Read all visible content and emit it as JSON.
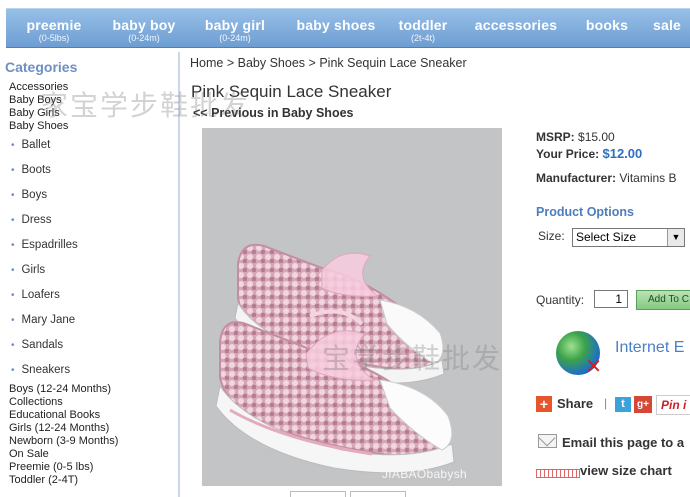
{
  "nav": [
    {
      "label": "preemie",
      "sub": "(0-5lbs)"
    },
    {
      "label": "baby boy",
      "sub": "(0-24m)"
    },
    {
      "label": "baby girl",
      "sub": "(0-24m)"
    },
    {
      "label": "baby shoes",
      "sub": ""
    },
    {
      "label": "toddler",
      "sub": "(2t-4t)"
    },
    {
      "label": "accessories",
      "sub": ""
    },
    {
      "label": "books",
      "sub": ""
    },
    {
      "label": "sale",
      "sub": ""
    }
  ],
  "sidebar": {
    "title": "Categories",
    "top_items": [
      "Accessories",
      "Baby Boys",
      "Baby Girls",
      "Baby Shoes"
    ],
    "shoe_items": [
      "Ballet",
      "Boots",
      "Boys",
      "Dress",
      "Espadrilles",
      "Girls",
      "Loafers",
      "Mary Jane",
      "Sandals",
      "Sneakers"
    ],
    "bottom_items": [
      "Boys (12-24 Months)",
      "Collections",
      "Educational Books",
      "Girls (12-24 Months)",
      "Newborn (3-9 Months)",
      "On Sale",
      "Preemie (0-5 lbs)",
      "Toddler (2-4T)"
    ]
  },
  "breadcrumb": [
    "Home",
    "Baby Shoes",
    "Pink Sequin Lace Sneaker"
  ],
  "breadcrumb_sep": ">",
  "product": {
    "title": "Pink Sequin Lace Sneaker",
    "previous_link": "<< Previous in Baby Shoes",
    "photo_watermark": "JIABAObabysh",
    "msrp_label": "MSRP:",
    "msrp_value": "$15.00",
    "price_label": "Your Price:",
    "price_value": "$12.00",
    "manufacturer_label": "Manufacturer:",
    "manufacturer_value": "Vitamins B"
  },
  "options": {
    "heading": "Product Options",
    "size_label": "Size:",
    "size_value": "Select Size",
    "quantity_label": "Quantity:",
    "quantity_value": "1",
    "add_label": "Add To C"
  },
  "ie_text": "Internet E",
  "share": {
    "label": "Share",
    "separator": "|",
    "twitter": "t",
    "gplus": "g+",
    "pinterest": "Pin i"
  },
  "email_label": "Email this page to a",
  "size_chart_label": "view size chart",
  "watermarks": [
    "家宝学步鞋批发",
    "宝学步鞋批发"
  ],
  "colors": {
    "nav_top": "#98c0e8",
    "nav_bottom": "#6d9dd2",
    "category_title": "#6f8fc4",
    "price": "#2f6fbf",
    "options_heading": "#4d7ebd"
  }
}
